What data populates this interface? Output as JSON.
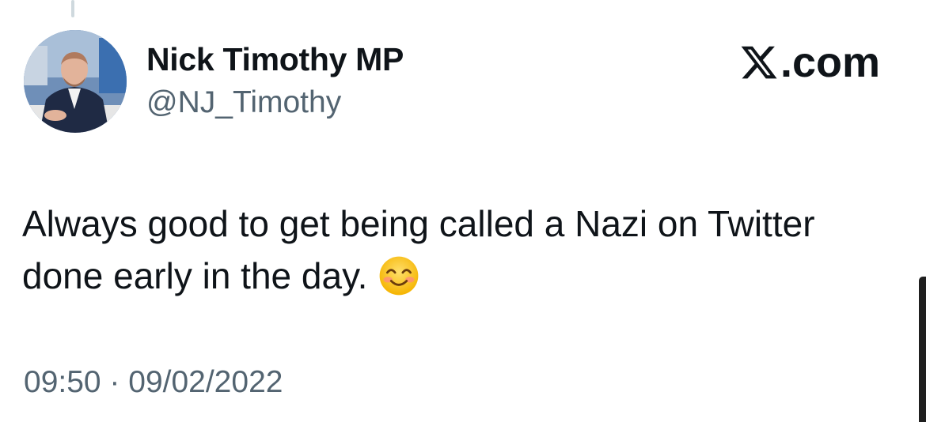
{
  "author": {
    "display_name": "Nick Timothy MP",
    "handle": "@NJ_Timothy"
  },
  "brand": {
    "icon": "x-logo-icon",
    "suffix": ".com"
  },
  "tweet": {
    "text_line_1": "Always good to get being called a Nazi on Twitter",
    "text_line_2": "done early in the day.",
    "emoji": "smiling-face-with-smiling-eyes-icon",
    "timestamp": "09:50 · 09/02/2022"
  },
  "colors": {
    "text": "#0f1419",
    "secondary": "#536471",
    "thread_line": "#cfd9de"
  }
}
